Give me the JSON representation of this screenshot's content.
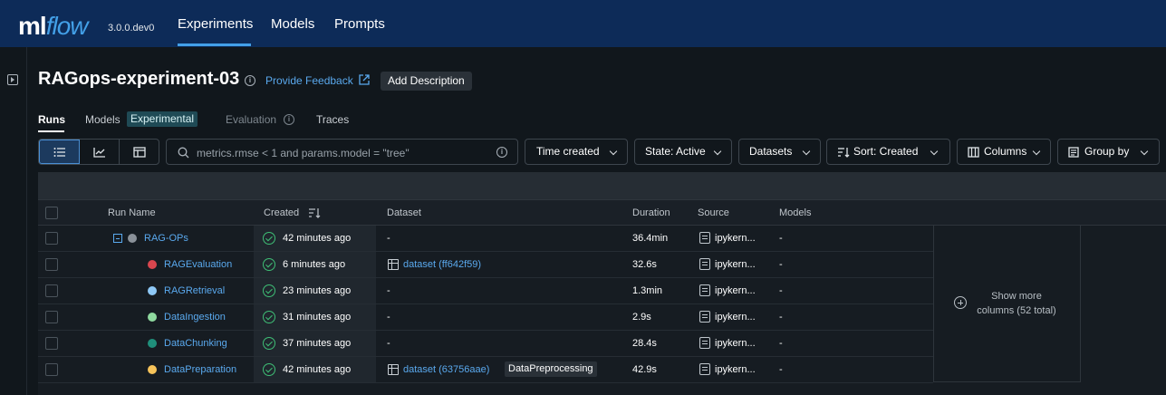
{
  "app": {
    "logo_ml": "ml",
    "logo_flow": "flow",
    "version": "3.0.0.dev0"
  },
  "nav": {
    "experiments": "Experiments",
    "models": "Models",
    "prompts": "Prompts"
  },
  "header": {
    "title": "RAGops-experiment-03",
    "info_icon": "i",
    "feedback": "Provide Feedback",
    "add_description": "Add Description"
  },
  "tabs": {
    "runs": "Runs",
    "models": "Models",
    "experimental_badge": "Experimental",
    "evaluation": "Evaluation",
    "traces": "Traces"
  },
  "toolbar": {
    "search_placeholder": "metrics.rmse < 1 and params.model = \"tree\"",
    "time_created": "Time created",
    "state": "State: Active",
    "datasets": "Datasets",
    "sort": "Sort: Created",
    "columns": "Columns",
    "group_by": "Group by"
  },
  "table": {
    "headers": {
      "run_name": "Run Name",
      "created": "Created",
      "dataset": "Dataset",
      "duration": "Duration",
      "source": "Source",
      "models": "Models"
    },
    "rows": [
      {
        "name": "RAG-OPs",
        "color": "#8a9199",
        "created": "42 minutes ago",
        "dataset": "-",
        "duration": "36.4min",
        "source": "ipykern...",
        "models": "-"
      },
      {
        "name": "RAGEvaluation",
        "color": "#d9464e",
        "created": "6 minutes ago",
        "dataset": "dataset (ff642f59)",
        "duration": "32.6s",
        "source": "ipykern...",
        "models": "-"
      },
      {
        "name": "RAGRetrieval",
        "color": "#8ec8f6",
        "created": "23 minutes ago",
        "dataset": "-",
        "duration": "1.3min",
        "source": "ipykern...",
        "models": "-"
      },
      {
        "name": "DataIngestion",
        "color": "#8fd99f",
        "created": "31 minutes ago",
        "dataset": "-",
        "duration": "2.9s",
        "source": "ipykern...",
        "models": "-"
      },
      {
        "name": "DataChunking",
        "color": "#1f8f7b",
        "created": "37 minutes ago",
        "dataset": "-",
        "duration": "28.4s",
        "source": "ipykern...",
        "models": "-"
      },
      {
        "name": "DataPreparation",
        "color": "#f6c35a",
        "created": "42 minutes ago",
        "dataset": "dataset (63756aae)",
        "dataset_tag": "DataPreprocessing",
        "duration": "42.9s",
        "source": "ipykern...",
        "models": "-"
      }
    ],
    "show_more_line1": "Show more",
    "show_more_line2": "columns (52 total)"
  }
}
